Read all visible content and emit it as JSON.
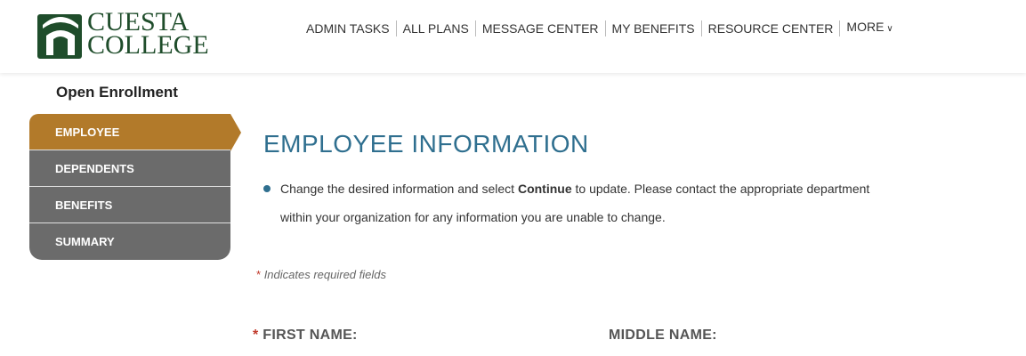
{
  "logo": {
    "line1": "CUESTA",
    "line2": "COLLEGE"
  },
  "topnav": {
    "items": [
      {
        "label": "ADMIN TASKS"
      },
      {
        "label": "ALL PLANS"
      },
      {
        "label": "MESSAGE CENTER"
      },
      {
        "label": "MY BENEFITS"
      },
      {
        "label": "RESOURCE CENTER"
      },
      {
        "label": "MORE"
      }
    ],
    "more_icon": "chevron-down-icon"
  },
  "sidebar": {
    "title": "Open Enrollment",
    "steps": [
      {
        "label": "EMPLOYEE",
        "active": true
      },
      {
        "label": "DEPENDENTS"
      },
      {
        "label": "BENEFITS"
      },
      {
        "label": "SUMMARY"
      }
    ]
  },
  "main": {
    "title": "EMPLOYEE INFORMATION",
    "instruction": {
      "before": "Change the desired information and select ",
      "bold": "Continue",
      "after": " to update. Please contact the appropriate department within your organization for any information you are unable to change."
    },
    "required_note": "Indicates required fields",
    "required_star": "*",
    "fields": [
      {
        "label": "FIRST NAME:",
        "required": true
      },
      {
        "label": "MIDDLE NAME:",
        "required": false
      }
    ]
  },
  "colors": {
    "active_step": "#b27a2a",
    "inactive_step": "#6b6b6b",
    "title": "#2f6f8f",
    "logo": "#1f4d2b",
    "required": "#c0392b"
  }
}
